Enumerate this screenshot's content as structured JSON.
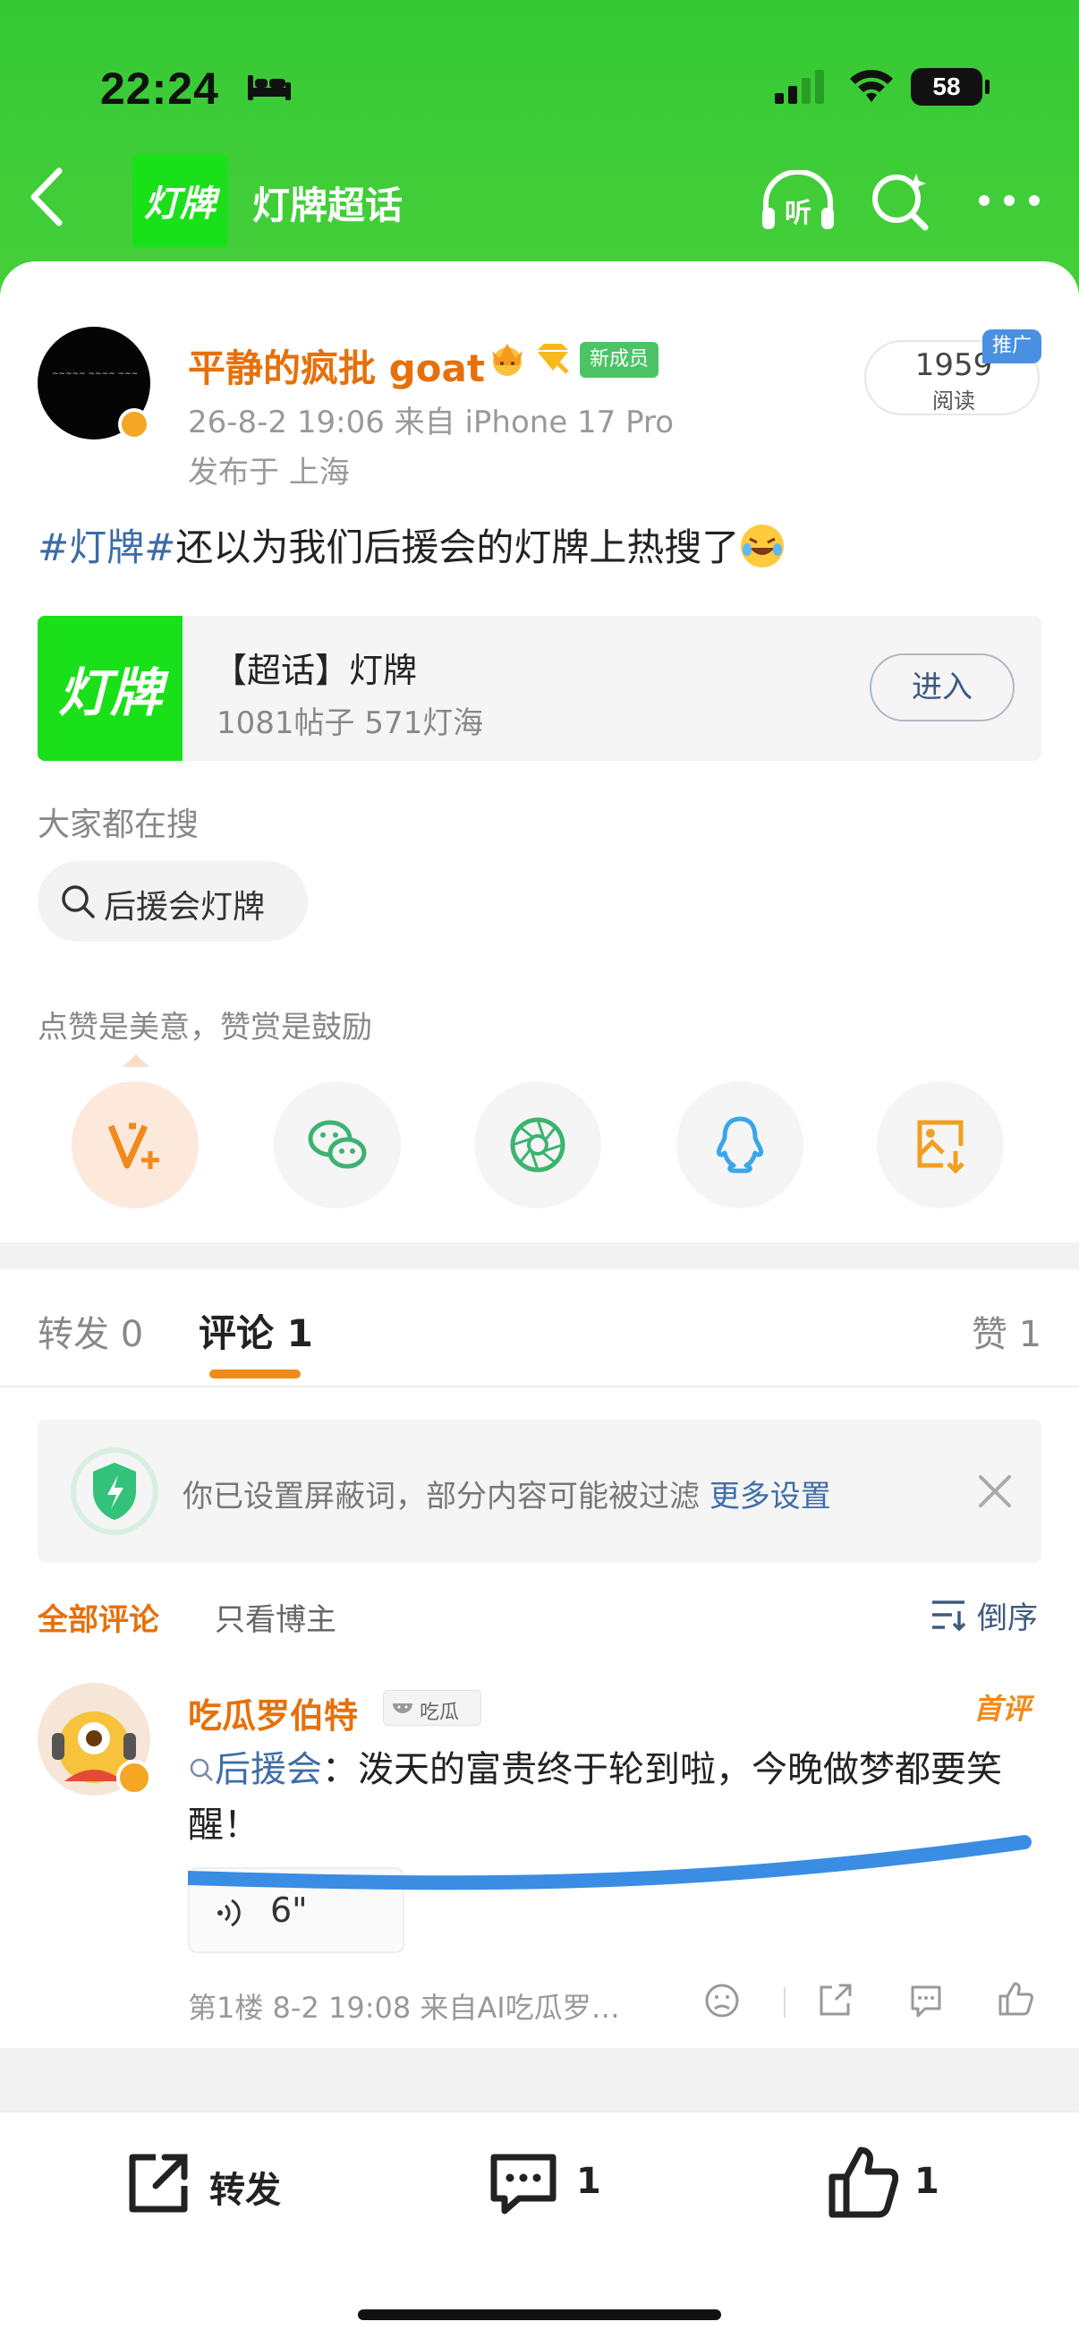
{
  "status_bar": {
    "time": "22:24",
    "battery": "58"
  },
  "nav": {
    "topic_logo_text": "灯牌",
    "title": "灯牌超话"
  },
  "post": {
    "username": "平静的疯批 goat",
    "member_badge": "新成员",
    "datetime_source": "26-8-2 19:06  来自 iPhone 17 Pro",
    "location": "发布于 上海",
    "read_count": "1959",
    "read_label": "阅读",
    "promo_badge": "推广",
    "hashtag": "#灯牌#",
    "text": "还以为我们后援会的灯牌上热搜了"
  },
  "super_topic": {
    "logo_text": "灯牌",
    "title": "【超话】灯牌",
    "stats": "1081帖子 571灯海",
    "enter_label": "进入"
  },
  "trending": {
    "heading": "大家都在搜",
    "chip": "后援会灯牌"
  },
  "reward": {
    "text": "点赞是美意，赞赏是鼓励"
  },
  "share_icons": [
    "reward-v-icon",
    "wechat-icon",
    "moments-icon",
    "qq-icon",
    "save-image-icon"
  ],
  "tabs": {
    "repost": "转发 0",
    "comments": "评论 1",
    "likes": "赞 1"
  },
  "notice": {
    "text": "你已设置屏蔽词，部分内容可能被过滤 ",
    "link": "更多设置"
  },
  "filters": {
    "all": "全部评论",
    "author_only": "只看博主",
    "sort": "倒序"
  },
  "comment": {
    "username": "吃瓜罗伯特",
    "badge": "吃瓜",
    "first_badge": "首评",
    "topic": "后援会",
    "text": "：泼天的富贵终于轮到啦，今晚做梦都要笑醒！",
    "audio_duration": "6\"",
    "meta": "第1楼 8-2 19:08  来自AI吃瓜罗…"
  },
  "bottom_bar": {
    "repost": "转发",
    "comment_count": "1",
    "like_count": "1"
  },
  "colors": {
    "header_green": "#3ccb36",
    "accent_orange": "#e6700a",
    "link_blue": "#3e6ea8"
  }
}
